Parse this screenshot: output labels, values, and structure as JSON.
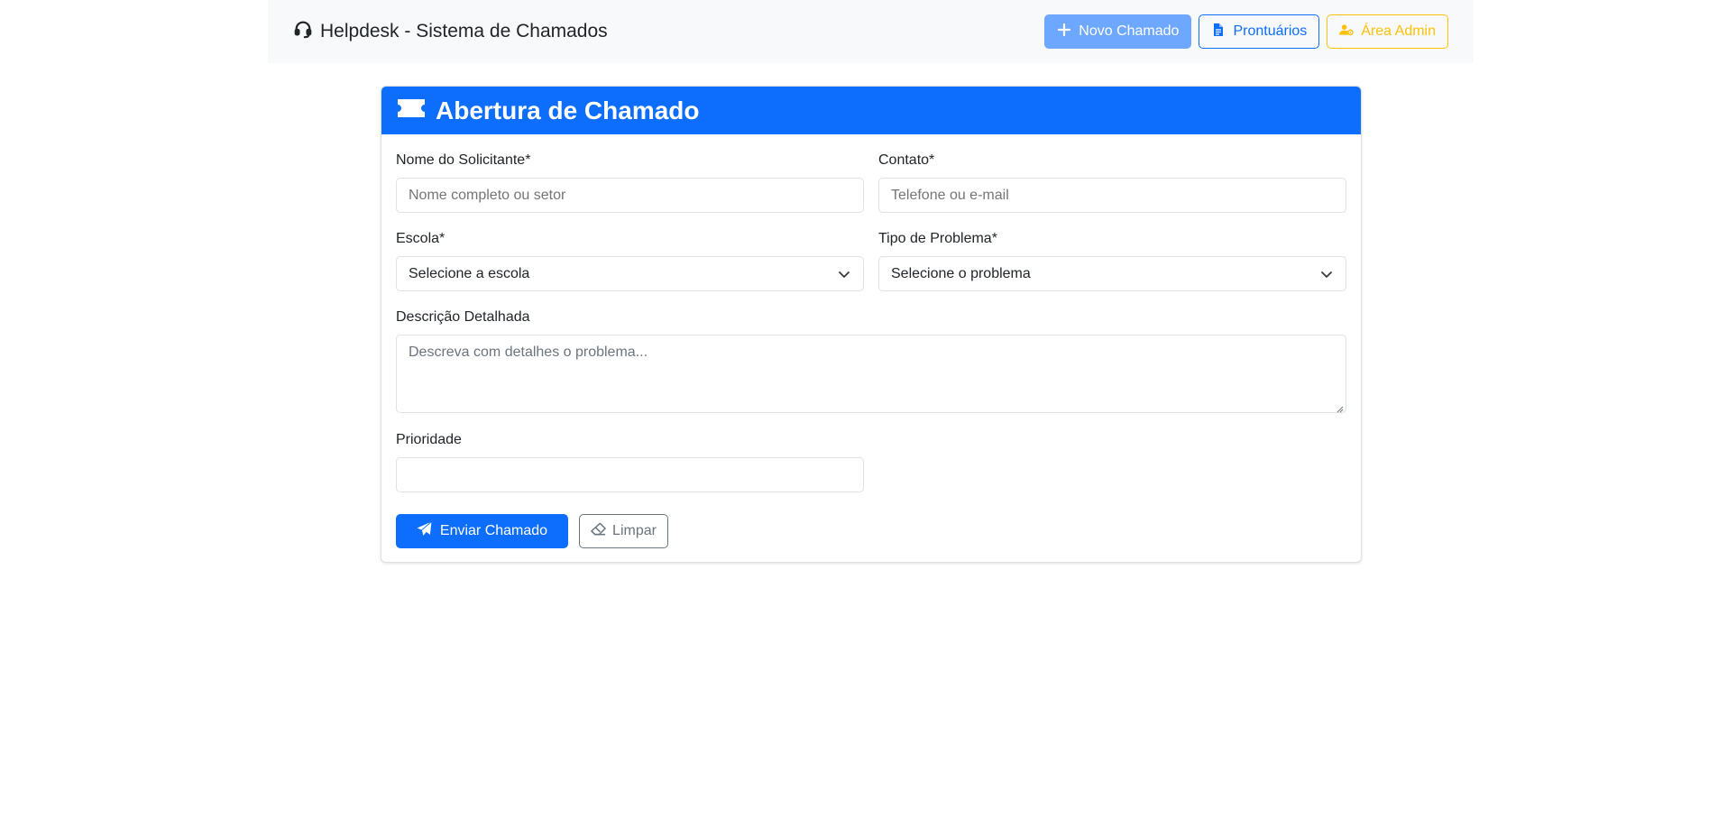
{
  "navbar": {
    "brand_icon": "headset-icon",
    "brand_title": "Helpdesk - Sistema de Chamados",
    "buttons": [
      {
        "label": "Novo Chamado",
        "icon": "plus-icon",
        "color": "#6ea8fe"
      },
      {
        "label": "Prontuários",
        "icon": "file-icon",
        "color": "#0d6efd"
      },
      {
        "label": "Área Admin",
        "icon": "user-gear-icon",
        "color": "#ffc107"
      }
    ]
  },
  "card": {
    "title": "Abertura de Chamado",
    "title_icon": "ticket-icon",
    "header_color": "#0d6efd"
  },
  "form": {
    "nome": {
      "label": "Nome do Solicitante*",
      "placeholder": "Nome completo ou setor",
      "value": ""
    },
    "contato": {
      "label": "Contato*",
      "placeholder": "Telefone ou e-mail",
      "value": ""
    },
    "escola": {
      "label": "Escola*",
      "selected": "Selecione a escola"
    },
    "tipo": {
      "label": "Tipo de Problema*",
      "selected": "Selecione o problema"
    },
    "descricao": {
      "label": "Descrição Detalhada",
      "placeholder": "Descreva com detalhes o problema...",
      "value": ""
    },
    "prioridade": {
      "label": "Prioridade",
      "value": ""
    }
  },
  "actions": {
    "send_label": "Enviar Chamado",
    "send_icon": "paper-plane-icon",
    "clear_label": "Limpar",
    "clear_icon": "eraser-icon"
  }
}
